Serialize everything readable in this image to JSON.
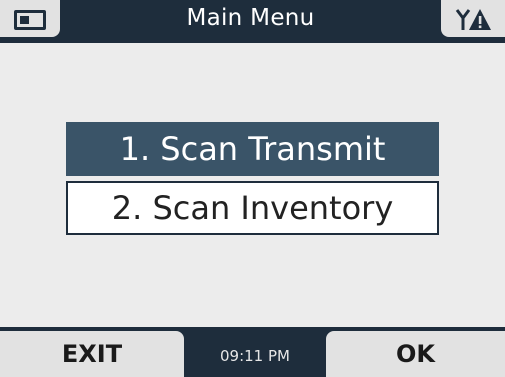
{
  "header": {
    "title": "Main Menu",
    "left_icon": "battery-icon",
    "right_icon": "antenna-signal-icon"
  },
  "menu": {
    "items": [
      {
        "label": "1. Scan Transmit",
        "selected": true
      },
      {
        "label": "2. Scan Inventory",
        "selected": false
      }
    ]
  },
  "footer": {
    "left_softkey": "EXIT",
    "time": "09:11 PM",
    "right_softkey": "OK"
  },
  "colors": {
    "bar": "#1e2d3c",
    "selected_item": "#3a5468",
    "background": "#ececec",
    "softkey": "#e2e2e2"
  }
}
